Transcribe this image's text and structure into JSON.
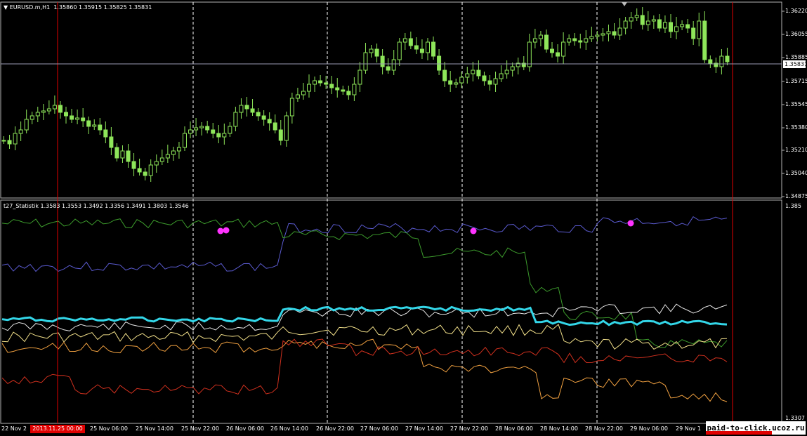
{
  "main_panel": {
    "symbol_title": "EURUSD.m,H1",
    "ohlc": "1.35860 1.35915 1.35825 1.35831",
    "price_labels": [
      "1.36220",
      "1.36055",
      "1.35885",
      "1.35715",
      "1.35545",
      "1.35380",
      "1.35210",
      "1.35040",
      "1.34875"
    ],
    "current_price": "1.35831",
    "candle_color": "#8ee65a",
    "grid_color": "#ffffff"
  },
  "indicator_panel": {
    "title": "t27_Statistik",
    "values": "1.3583 1.3553 1.3492 1.3356 1.3491 1.3803 1.3546",
    "scale_top": "1.385",
    "scale_bottom": "1.3307",
    "colors": {
      "cyan": "#33d6e8",
      "blue": "#5a5acf",
      "green": "#3c9b2c",
      "white": "#e8e8e8",
      "light_yellow": "#f2e08a",
      "orange": "#f0a040",
      "red": "#d0301e",
      "markers": "#ff33ff"
    }
  },
  "time_axis": {
    "labels": [
      "22 Nov 2",
      "25 Nov 06:00",
      "25 Nov 14:00",
      "25 Nov 22:00",
      "26 Nov 06:00",
      "26 Nov 14:00",
      "26 Nov 22:00",
      "27 Nov 06:00",
      "27 Nov 14:00",
      "27 Nov 22:00",
      "28 Nov 06:00",
      "28 Nov 14:00",
      "28 Nov 22:00",
      "29 Nov 06:00",
      "29 Nov 1"
    ],
    "highlighted_time": "2013.11.25 00:00"
  },
  "watermark": "paid-to-click.ucoz.ru"
}
